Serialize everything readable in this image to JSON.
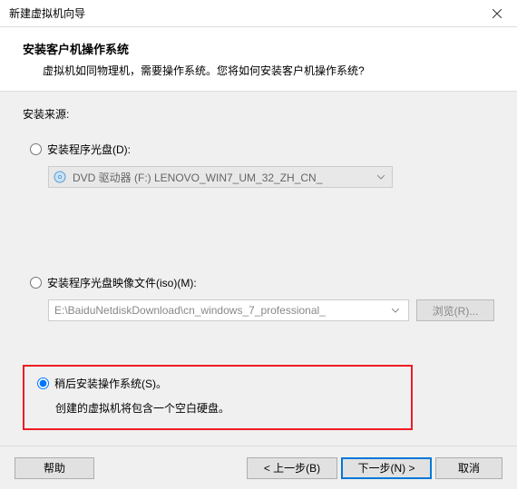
{
  "window": {
    "title": "新建虚拟机向导"
  },
  "header": {
    "title": "安装客户机操作系统",
    "desc": "虚拟机如同物理机，需要操作系统。您将如何安装客户机操作系统?"
  },
  "source_label": "安装来源:",
  "option_disc": {
    "label": "安装程序光盘(D):",
    "dropdown": "DVD 驱动器 (F:) LENOVO_WIN7_UM_32_ZH_CN_"
  },
  "option_iso": {
    "label": "安装程序光盘映像文件(iso)(M):",
    "path": "E:\\BaiduNetdiskDownload\\cn_windows_7_professional_",
    "browse": "浏览(R)..."
  },
  "option_later": {
    "label": "稍后安装操作系统(S)。",
    "desc": "创建的虚拟机将包含一个空白硬盘。"
  },
  "footer": {
    "help": "帮助",
    "back": "< 上一步(B)",
    "next": "下一步(N) >",
    "cancel": "取消"
  }
}
